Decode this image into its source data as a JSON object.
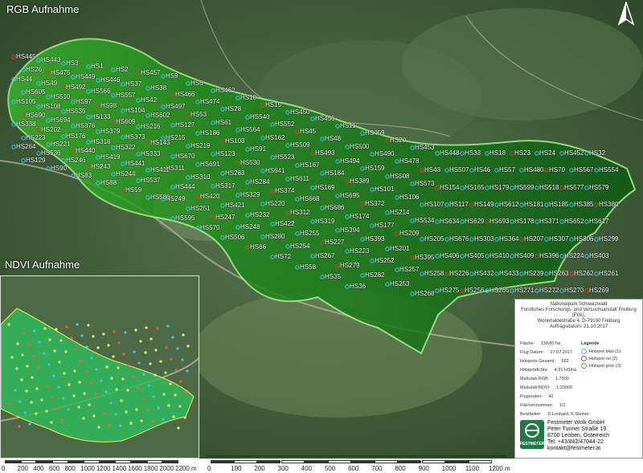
{
  "titles": {
    "rgb": "RGB Aufnahme",
    "ndvi": "NDVI Aufnahme"
  },
  "colors": {
    "forest_dark": "#2f4a2c",
    "area_green": "#1f8a1a",
    "boundary": "#a5f58a",
    "red_spot": "#e23a2a",
    "blue_spot": "#38c7ff"
  },
  "hotspot_labels": [
    {
      "t": "HS445"
    },
    {
      "t": "HS443"
    },
    {
      "t": "HS3"
    },
    {
      "t": "HS1"
    },
    {
      "t": "HS2"
    },
    {
      "t": "HS457"
    },
    {
      "t": "HS9"
    },
    {
      "t": "HS6"
    },
    {
      "t": "HS462"
    },
    {
      "t": "HS10"
    },
    {
      "t": "HS15"
    },
    {
      "t": "HS450"
    },
    {
      "t": "HS456"
    },
    {
      "t": "HS11"
    },
    {
      "t": "HS459"
    },
    {
      "t": "HS20"
    },
    {
      "t": "HS453"
    },
    {
      "t": "HS448"
    },
    {
      "t": "HS33"
    },
    {
      "t": "HS18"
    },
    {
      "t": "HS23"
    },
    {
      "t": "HS24"
    },
    {
      "t": "HS452"
    },
    {
      "t": "HS32"
    },
    {
      "t": "HS26"
    },
    {
      "t": "HS475"
    },
    {
      "t": "HS449"
    },
    {
      "t": "HS446"
    },
    {
      "t": "HS37"
    },
    {
      "t": "HS38"
    },
    {
      "t": "HS466"
    },
    {
      "t": "HS474"
    },
    {
      "t": "HS28"
    },
    {
      "t": "HS540"
    },
    {
      "t": "HS552"
    },
    {
      "t": "HS45"
    },
    {
      "t": "HS48"
    },
    {
      "t": "HS500"
    },
    {
      "t": "HS490"
    },
    {
      "t": "HS478"
    },
    {
      "t": "HS43"
    },
    {
      "t": "HS507"
    },
    {
      "t": "HS46"
    },
    {
      "t": "HS57"
    },
    {
      "t": "HS480"
    },
    {
      "t": "HS70"
    },
    {
      "t": "HS567"
    },
    {
      "t": "HS554"
    },
    {
      "t": "HS44"
    },
    {
      "t": "HS49"
    },
    {
      "t": "HS492"
    },
    {
      "t": "HS566"
    },
    {
      "t": "HS557"
    },
    {
      "t": "HS42"
    },
    {
      "t": "HS497"
    },
    {
      "t": "HS53"
    },
    {
      "t": "HS61"
    },
    {
      "t": "HS564"
    },
    {
      "t": "HS162"
    },
    {
      "t": "HS509"
    },
    {
      "t": "HS493"
    },
    {
      "t": "HS494"
    },
    {
      "t": "HS159"
    },
    {
      "t": "HS508"
    },
    {
      "t": "HS573"
    },
    {
      "t": "HS154"
    },
    {
      "t": "HS165"
    },
    {
      "t": "HS179"
    },
    {
      "t": "HS599"
    },
    {
      "t": "HS518"
    },
    {
      "t": "HS577"
    },
    {
      "t": "HS579"
    },
    {
      "t": "HS605"
    },
    {
      "t": "HS510"
    },
    {
      "t": "HS97"
    },
    {
      "t": "HS98"
    },
    {
      "t": "HS104"
    },
    {
      "t": "HS602"
    },
    {
      "t": "HS127"
    },
    {
      "t": "HS186"
    },
    {
      "t": "HS103"
    },
    {
      "t": "HS91"
    },
    {
      "t": "HS523"
    },
    {
      "t": "HS167"
    },
    {
      "t": "HS184"
    },
    {
      "t": "HS389"
    },
    {
      "t": "HS101"
    },
    {
      "t": "HS106"
    },
    {
      "t": "HS107"
    },
    {
      "t": "HS117"
    },
    {
      "t": "HS149"
    },
    {
      "t": "HS612"
    },
    {
      "t": "HS181"
    },
    {
      "t": "HS185"
    },
    {
      "t": "HS385"
    },
    {
      "t": "HS380"
    },
    {
      "t": "HS105"
    },
    {
      "t": "HS108"
    },
    {
      "t": "HS535"
    },
    {
      "t": "HS133"
    },
    {
      "t": "HS609"
    },
    {
      "t": "HS216"
    },
    {
      "t": "HS215"
    },
    {
      "t": "HS219"
    },
    {
      "t": "HS123"
    },
    {
      "t": "HS530"
    },
    {
      "t": "HS641"
    },
    {
      "t": "HS611"
    },
    {
      "t": "HS169"
    },
    {
      "t": "HS695"
    },
    {
      "t": "HS372"
    },
    {
      "t": "HS214"
    },
    {
      "t": "HS534"
    },
    {
      "t": "HS634"
    },
    {
      "t": "HS629"
    },
    {
      "t": "HS693"
    },
    {
      "t": "HS178"
    },
    {
      "t": "HS371"
    },
    {
      "t": "HS652"
    },
    {
      "t": "HS617"
    },
    {
      "t": "HS690"
    },
    {
      "t": "HS694"
    },
    {
      "t": "HS376"
    },
    {
      "t": "HS379"
    },
    {
      "t": "HS373"
    },
    {
      "t": "HS143"
    },
    {
      "t": "HS670"
    },
    {
      "t": "HS691"
    },
    {
      "t": "HS283"
    },
    {
      "t": "HS284"
    },
    {
      "t": "HS374"
    },
    {
      "t": "HS668"
    },
    {
      "t": "HS686"
    },
    {
      "t": "HS174"
    },
    {
      "t": "HS177"
    },
    {
      "t": "HS209"
    },
    {
      "t": "HS205"
    },
    {
      "t": "HS676"
    },
    {
      "t": "HS303"
    },
    {
      "t": "HS364"
    },
    {
      "t": "HS207"
    },
    {
      "t": "HS307"
    },
    {
      "t": "HS306"
    },
    {
      "t": "HS299"
    },
    {
      "t": "HS338"
    },
    {
      "t": "HS202"
    },
    {
      "t": "HS176"
    },
    {
      "t": "HS318"
    },
    {
      "t": "HS322"
    },
    {
      "t": "HS333"
    },
    {
      "t": "HS311"
    },
    {
      "t": "HS310"
    },
    {
      "t": "HS317"
    },
    {
      "t": "HS329"
    },
    {
      "t": "HS220"
    },
    {
      "t": "HS312"
    },
    {
      "t": "HS319"
    },
    {
      "t": "HS394"
    },
    {
      "t": "HS393"
    },
    {
      "t": "HS201"
    },
    {
      "t": "HS395"
    },
    {
      "t": "HS406"
    },
    {
      "t": "HS405"
    },
    {
      "t": "HS410"
    },
    {
      "t": "HS409"
    },
    {
      "t": "HS396"
    },
    {
      "t": "HS224"
    },
    {
      "t": "HS403"
    },
    {
      "t": "HS223"
    },
    {
      "t": "HS221"
    },
    {
      "t": "HS440"
    },
    {
      "t": "HS419"
    },
    {
      "t": "HS441"
    },
    {
      "t": "HS411"
    },
    {
      "t": "HS444"
    },
    {
      "t": "HS420"
    },
    {
      "t": "HS421"
    },
    {
      "t": "HS232"
    },
    {
      "t": "HS422"
    },
    {
      "t": "HS255"
    },
    {
      "t": "HS227"
    },
    {
      "t": "HS223"
    },
    {
      "t": "HS252"
    },
    {
      "t": "HS257"
    },
    {
      "t": "HS258"
    },
    {
      "t": "HS226"
    },
    {
      "t": "HS432"
    },
    {
      "t": "HS433"
    },
    {
      "t": "HS239"
    },
    {
      "t": "HS263"
    },
    {
      "t": "HS262"
    },
    {
      "t": "HS261"
    },
    {
      "t": "HS264"
    },
    {
      "t": "HS536"
    },
    {
      "t": "HS246"
    },
    {
      "t": "HS243"
    },
    {
      "t": "HS244"
    },
    {
      "t": "HS537"
    },
    {
      "t": "HS249"
    },
    {
      "t": "HS251"
    },
    {
      "t": "HS247"
    },
    {
      "t": "HS248"
    },
    {
      "t": "HS280"
    },
    {
      "t": "HS254"
    },
    {
      "t": "HS267"
    },
    {
      "t": "HS279"
    },
    {
      "t": "HS282"
    },
    {
      "t": "HS253"
    },
    {
      "t": "HS268"
    },
    {
      "t": "HS275"
    },
    {
      "t": "HS256"
    },
    {
      "t": "HS265"
    },
    {
      "t": "HS271"
    },
    {
      "t": "HS272"
    },
    {
      "t": "HS270"
    },
    {
      "t": "HS269"
    },
    {
      "t": "HS129"
    },
    {
      "t": "HS90"
    },
    {
      "t": "HS83"
    },
    {
      "t": "HS88"
    },
    {
      "t": "HS59"
    },
    {
      "t": "HS586"
    },
    {
      "t": "HS595"
    },
    {
      "t": "HS570"
    },
    {
      "t": "HS506"
    },
    {
      "t": "HS66"
    },
    {
      "t": "HS72"
    },
    {
      "t": "HS58"
    },
    {
      "t": "HS35"
    },
    {
      "t": "HS36"
    }
  ],
  "scalebars": {
    "ndvi": [
      "0",
      "200",
      "400",
      "600",
      "800",
      "1000",
      "1200",
      "1400",
      "1600",
      "1800",
      "2000",
      "2200 m"
    ],
    "rgb": [
      "0",
      "100",
      "200",
      "300",
      "400",
      "500",
      "600",
      "700",
      "800",
      "900",
      "1000",
      "1100",
      "1200 m"
    ]
  },
  "legend": {
    "heading": [
      "Nationalpark Schwarzwald",
      "Forstliches Forschungs- und Versuchsanstalt Freiburg (FVA),",
      "Wonnhaldestraße 4, D-79100 Freiburg",
      "Auftragsdatum: 21.10.2017"
    ],
    "rows": [
      {
        "k": "Fläche:",
        "v": "138.80 ha"
      },
      {
        "k": "Flug Datum:",
        "v": "27.07.2017"
      },
      {
        "k": "Hotspots Gesamt:",
        "v": "682"
      },
      {
        "k": "Hotspotdichte:",
        "v": "4,91 HS/ha"
      },
      {
        "k": "Maßstab RGB:",
        "v": "1:7500"
      },
      {
        "k": "Maßstab NDVI:",
        "v": "1:20000"
      },
      {
        "k": "Flugrouten:",
        "v": "42"
      },
      {
        "k": "Flächennummer:",
        "v": "1/1"
      },
      {
        "k": "Bearbeiter:",
        "v": "D.Lenhard, K.Steiner"
      }
    ],
    "legende_title": "Legende",
    "legende_items": [
      "Hotspot blau (1)",
      "Hotspot rot (2)",
      "Hotspot grün (3)"
    ],
    "company": [
      "Festmeter Wolk GmbH",
      "Peter Tunner Straße 19",
      "8700 Leoben, Österreich",
      "Tel: +43/842/47044-22",
      "kontakt@festmeter.at"
    ],
    "logo": "FESTMETER"
  }
}
